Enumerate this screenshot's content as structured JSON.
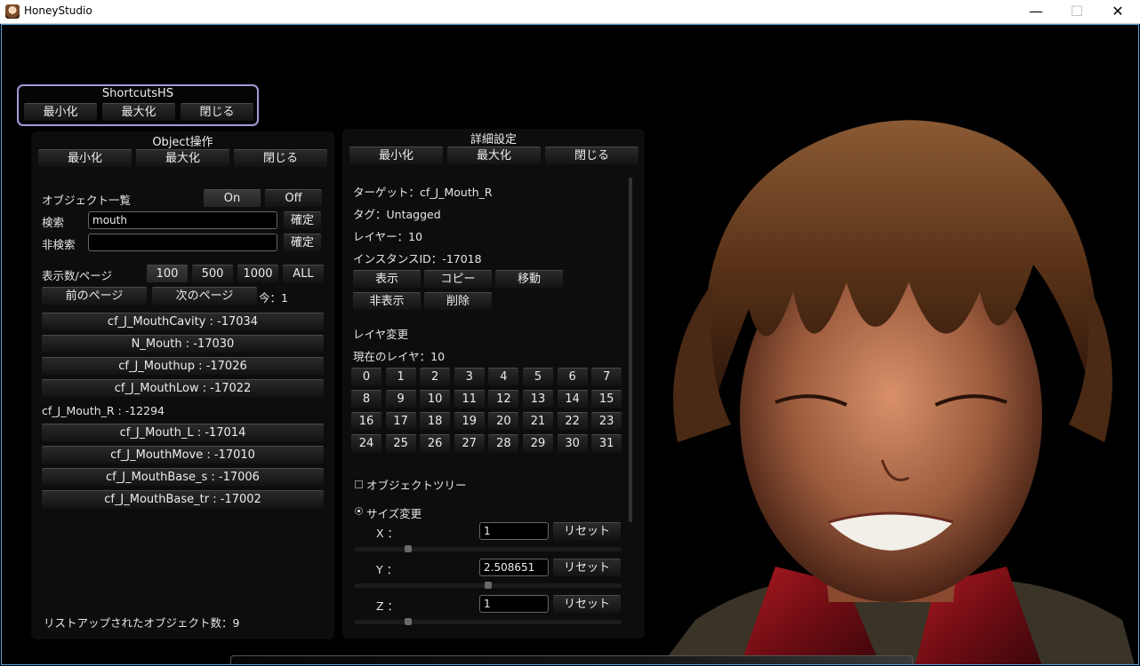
{
  "window": {
    "title": "HoneyStudio",
    "min": "—",
    "max": "☐",
    "close": "✕"
  },
  "shortcuts": {
    "title": "ShortcutsHS",
    "buttons": [
      "最小化",
      "最大化",
      "閉じる"
    ]
  },
  "object_panel": {
    "title": "Object操作",
    "buttons": [
      "最小化",
      "最大化",
      "閉じる"
    ],
    "list_label": "オブジェクト一覧",
    "on": "On",
    "off": "Off",
    "search_label": "検索",
    "search_value": "mouth",
    "search_confirm": "確定",
    "exclude_label": "非検索",
    "exclude_value": "",
    "exclude_confirm": "確定",
    "per_page_label": "表示数/ページ",
    "per_page_options": [
      "100",
      "500",
      "1000",
      "ALL"
    ],
    "prev_page": "前のページ",
    "next_page": "次のページ",
    "current_page": "今：1",
    "items": [
      "cf_J_MouthCavity : -17034",
      "N_Mouth : -17030",
      "cf_J_Mouthup : -17026",
      "cf_J_MouthLow : -17022",
      "cf_J_Mouth_R : -12294",
      "cf_J_Mouth_L : -17014",
      "cf_J_MouthMove : -17010",
      "cf_J_MouthBase_s : -17006",
      "cf_J_MouthBase_tr : -17002"
    ],
    "footer": "リストアップされたオブジェクト数：9"
  },
  "detail_panel": {
    "title": "詳細設定",
    "buttons": [
      "最小化",
      "最大化",
      "閉じる"
    ],
    "target": "ターゲット：cf_J_Mouth_R",
    "tag": "タグ：Untagged",
    "layer": "レイヤー：10",
    "instance": "インスタンスID：-17018",
    "actions": [
      "表示",
      "コピー",
      "移動",
      "非表示",
      "削除"
    ],
    "layer_change": "レイヤ変更",
    "current_layer": "現在のレイヤ：10",
    "layers": [
      "0",
      "1",
      "2",
      "3",
      "4",
      "5",
      "6",
      "7",
      "8",
      "9",
      "10",
      "11",
      "12",
      "13",
      "14",
      "15",
      "16",
      "17",
      "18",
      "19",
      "20",
      "21",
      "22",
      "23",
      "24",
      "25",
      "26",
      "27",
      "28",
      "29",
      "30",
      "31"
    ],
    "tree_label": "オブジェクトツリー",
    "size_label": "サイズ変更",
    "axes": [
      {
        "label": "X ：",
        "value": "1",
        "reset": "リセット",
        "slider": 0.2
      },
      {
        "label": "Y ：",
        "value": "2.508651",
        "reset": "リセット",
        "slider": 0.5
      },
      {
        "label": "Z ：",
        "value": "1",
        "reset": "リセット",
        "slider": 0.2
      }
    ]
  }
}
